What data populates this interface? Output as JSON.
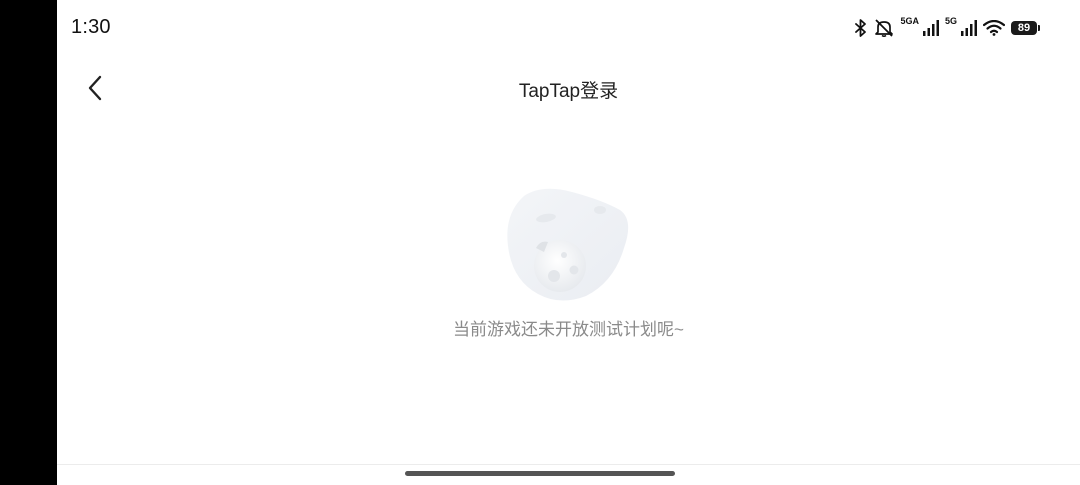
{
  "status_bar": {
    "time": "1:30",
    "network_1": "5GA",
    "network_2": "5G",
    "battery": "89",
    "icons": [
      "bluetooth-icon",
      "mute-icon",
      "signal-icon",
      "signal-icon",
      "wifi-icon",
      "battery-icon"
    ]
  },
  "header": {
    "title": "TapTap登录",
    "back_icon": "chevron-left-icon"
  },
  "empty_state": {
    "message": "当前游戏还未开放测试计划呢~",
    "illustration": "planet-illustration"
  }
}
